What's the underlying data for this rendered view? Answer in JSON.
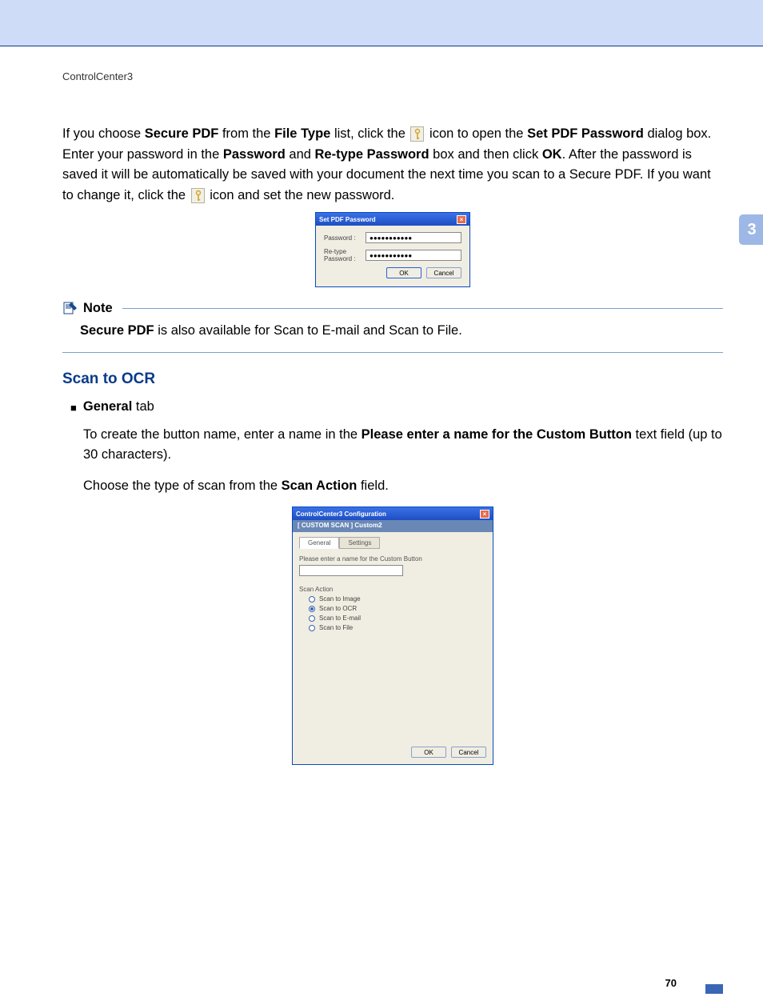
{
  "header": {
    "section": "ControlCenter3"
  },
  "chapter": "3",
  "page_number": "70",
  "para1": {
    "t1": "If you choose ",
    "b1": "Secure PDF",
    "t2": " from the ",
    "b2": "File Type",
    "t3": " list, click the ",
    "t4": " icon to open the ",
    "b4": "Set PDF Password",
    "t5": " dialog box. Enter your password in the ",
    "b5": "Password",
    "t6": " and ",
    "b6": "Re-type Password",
    "t7": " box and then click ",
    "b7": "OK",
    "t8": ". After the password is saved it will be automatically be saved with your document the next time you scan to a Secure PDF. If you want to change it, click the ",
    "t9": " icon and set the new password."
  },
  "dlg1": {
    "title": "Set PDF Password",
    "password_label": "Password :",
    "retype_label": "Re-type Password :",
    "password_value": "●●●●●●●●●●●",
    "retype_value": "●●●●●●●●●●●",
    "ok": "OK",
    "cancel": "Cancel"
  },
  "note": {
    "title": "Note",
    "b1": "Secure PDF",
    "t1": " is also available for Scan to E-mail and Scan to File."
  },
  "ocr": {
    "heading": "Scan to OCR",
    "bullet_b": "General",
    "bullet_t": " tab",
    "p1a": "To create the button name, enter a name in the ",
    "p1b": "Please enter a name for the Custom Button",
    "p1c": " text field (up to 30 characters).",
    "p2a": "Choose the type of scan from the ",
    "p2b": "Scan Action",
    "p2c": " field."
  },
  "dlg2": {
    "title": "ControlCenter3 Configuration",
    "subtitle": "[ CUSTOM SCAN ]   Custom2",
    "tab_general": "General",
    "tab_settings": "Settings",
    "name_label": "Please enter a name for the Custom Button",
    "action_label": "Scan Action",
    "options": {
      "image": "Scan to Image",
      "ocr": "Scan to OCR",
      "email": "Scan to E-mail",
      "file": "Scan to File"
    },
    "ok": "OK",
    "cancel": "Cancel"
  }
}
